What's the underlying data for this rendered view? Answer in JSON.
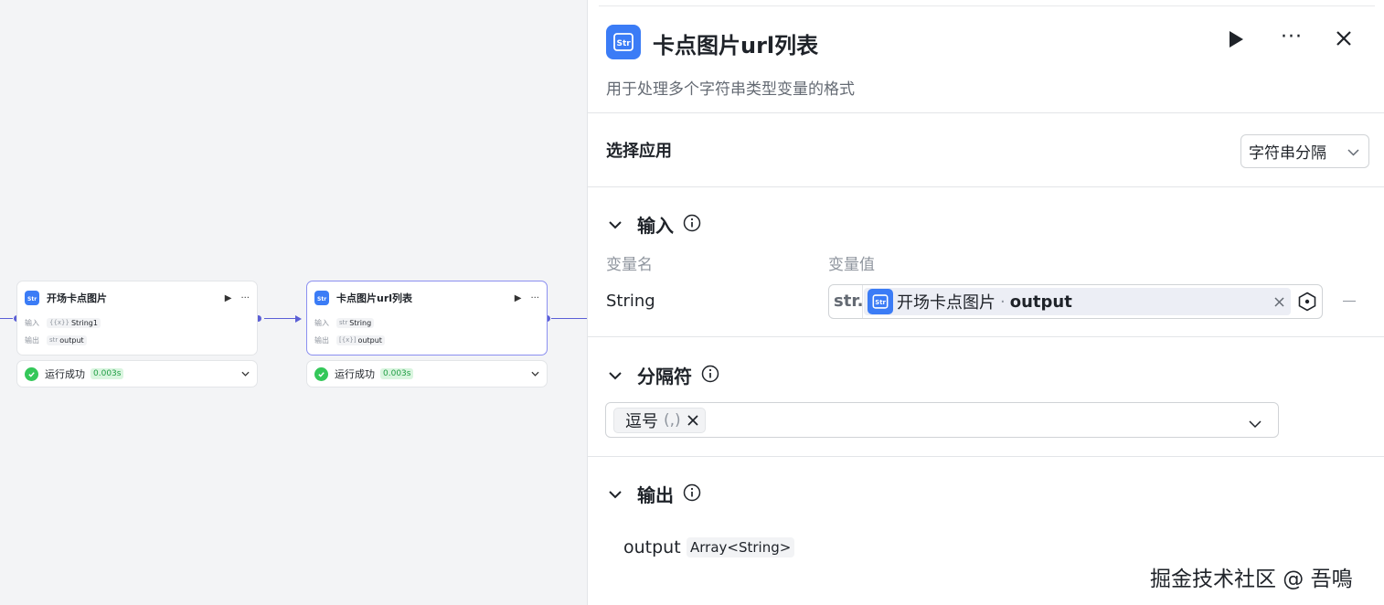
{
  "canvas": {
    "nodes": [
      {
        "title": "开场卡点图片",
        "input_label": "输入",
        "input_type": "{{x}}",
        "input_value": "String1",
        "output_label": "输出",
        "output_type": "str",
        "output_value": "output",
        "status_text": "运行成功",
        "status_time": "0.003s"
      },
      {
        "title": "卡点图片url列表",
        "input_label": "输入",
        "input_type": "str",
        "input_value": "String",
        "output_label": "输出",
        "output_type": "[{x}]",
        "output_value": "output",
        "status_text": "运行成功",
        "status_time": "0.003s"
      }
    ]
  },
  "panel": {
    "title": "卡点图片url列表",
    "description": "用于处理多个字符串类型变量的格式",
    "select_app_label": "选择应用",
    "select_app_value": "字符串分隔",
    "input_section": {
      "label": "输入",
      "col_name": "变量名",
      "col_value": "变量值",
      "row": {
        "name": "String",
        "type": "str.",
        "ref_node": "开场卡点图片",
        "ref_dot": "·",
        "ref_field": "output"
      }
    },
    "separator_section": {
      "label": "分隔符",
      "chip_label": "逗号",
      "chip_value": "(,)"
    },
    "output_section": {
      "label": "输出",
      "name": "output",
      "type": "Array<String>"
    }
  },
  "watermark": "掘金技术社区 @ 吾鳴",
  "colors": {
    "accent": "#3b7cf6",
    "edge": "#5b5fd6",
    "success": "#34c759"
  }
}
